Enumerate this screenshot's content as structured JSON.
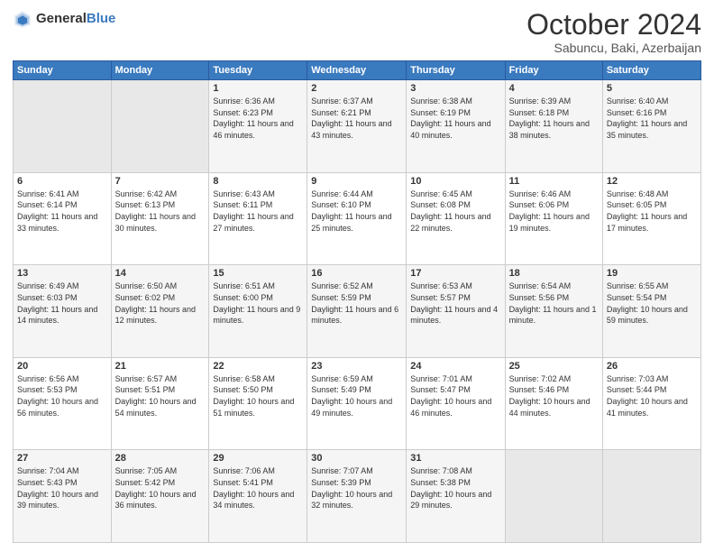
{
  "header": {
    "logo": {
      "general": "General",
      "blue": "Blue"
    },
    "title": "October 2024",
    "location": "Sabuncu, Baki, Azerbaijan"
  },
  "columns": [
    "Sunday",
    "Monday",
    "Tuesday",
    "Wednesday",
    "Thursday",
    "Friday",
    "Saturday"
  ],
  "weeks": [
    [
      {
        "day": "",
        "sunrise": "",
        "sunset": "",
        "daylight": ""
      },
      {
        "day": "",
        "sunrise": "",
        "sunset": "",
        "daylight": ""
      },
      {
        "day": "1",
        "sunrise": "Sunrise: 6:36 AM",
        "sunset": "Sunset: 6:23 PM",
        "daylight": "Daylight: 11 hours and 46 minutes."
      },
      {
        "day": "2",
        "sunrise": "Sunrise: 6:37 AM",
        "sunset": "Sunset: 6:21 PM",
        "daylight": "Daylight: 11 hours and 43 minutes."
      },
      {
        "day": "3",
        "sunrise": "Sunrise: 6:38 AM",
        "sunset": "Sunset: 6:19 PM",
        "daylight": "Daylight: 11 hours and 40 minutes."
      },
      {
        "day": "4",
        "sunrise": "Sunrise: 6:39 AM",
        "sunset": "Sunset: 6:18 PM",
        "daylight": "Daylight: 11 hours and 38 minutes."
      },
      {
        "day": "5",
        "sunrise": "Sunrise: 6:40 AM",
        "sunset": "Sunset: 6:16 PM",
        "daylight": "Daylight: 11 hours and 35 minutes."
      }
    ],
    [
      {
        "day": "6",
        "sunrise": "Sunrise: 6:41 AM",
        "sunset": "Sunset: 6:14 PM",
        "daylight": "Daylight: 11 hours and 33 minutes."
      },
      {
        "day": "7",
        "sunrise": "Sunrise: 6:42 AM",
        "sunset": "Sunset: 6:13 PM",
        "daylight": "Daylight: 11 hours and 30 minutes."
      },
      {
        "day": "8",
        "sunrise": "Sunrise: 6:43 AM",
        "sunset": "Sunset: 6:11 PM",
        "daylight": "Daylight: 11 hours and 27 minutes."
      },
      {
        "day": "9",
        "sunrise": "Sunrise: 6:44 AM",
        "sunset": "Sunset: 6:10 PM",
        "daylight": "Daylight: 11 hours and 25 minutes."
      },
      {
        "day": "10",
        "sunrise": "Sunrise: 6:45 AM",
        "sunset": "Sunset: 6:08 PM",
        "daylight": "Daylight: 11 hours and 22 minutes."
      },
      {
        "day": "11",
        "sunrise": "Sunrise: 6:46 AM",
        "sunset": "Sunset: 6:06 PM",
        "daylight": "Daylight: 11 hours and 19 minutes."
      },
      {
        "day": "12",
        "sunrise": "Sunrise: 6:48 AM",
        "sunset": "Sunset: 6:05 PM",
        "daylight": "Daylight: 11 hours and 17 minutes."
      }
    ],
    [
      {
        "day": "13",
        "sunrise": "Sunrise: 6:49 AM",
        "sunset": "Sunset: 6:03 PM",
        "daylight": "Daylight: 11 hours and 14 minutes."
      },
      {
        "day": "14",
        "sunrise": "Sunrise: 6:50 AM",
        "sunset": "Sunset: 6:02 PM",
        "daylight": "Daylight: 11 hours and 12 minutes."
      },
      {
        "day": "15",
        "sunrise": "Sunrise: 6:51 AM",
        "sunset": "Sunset: 6:00 PM",
        "daylight": "Daylight: 11 hours and 9 minutes."
      },
      {
        "day": "16",
        "sunrise": "Sunrise: 6:52 AM",
        "sunset": "Sunset: 5:59 PM",
        "daylight": "Daylight: 11 hours and 6 minutes."
      },
      {
        "day": "17",
        "sunrise": "Sunrise: 6:53 AM",
        "sunset": "Sunset: 5:57 PM",
        "daylight": "Daylight: 11 hours and 4 minutes."
      },
      {
        "day": "18",
        "sunrise": "Sunrise: 6:54 AM",
        "sunset": "Sunset: 5:56 PM",
        "daylight": "Daylight: 11 hours and 1 minute."
      },
      {
        "day": "19",
        "sunrise": "Sunrise: 6:55 AM",
        "sunset": "Sunset: 5:54 PM",
        "daylight": "Daylight: 10 hours and 59 minutes."
      }
    ],
    [
      {
        "day": "20",
        "sunrise": "Sunrise: 6:56 AM",
        "sunset": "Sunset: 5:53 PM",
        "daylight": "Daylight: 10 hours and 56 minutes."
      },
      {
        "day": "21",
        "sunrise": "Sunrise: 6:57 AM",
        "sunset": "Sunset: 5:51 PM",
        "daylight": "Daylight: 10 hours and 54 minutes."
      },
      {
        "day": "22",
        "sunrise": "Sunrise: 6:58 AM",
        "sunset": "Sunset: 5:50 PM",
        "daylight": "Daylight: 10 hours and 51 minutes."
      },
      {
        "day": "23",
        "sunrise": "Sunrise: 6:59 AM",
        "sunset": "Sunset: 5:49 PM",
        "daylight": "Daylight: 10 hours and 49 minutes."
      },
      {
        "day": "24",
        "sunrise": "Sunrise: 7:01 AM",
        "sunset": "Sunset: 5:47 PM",
        "daylight": "Daylight: 10 hours and 46 minutes."
      },
      {
        "day": "25",
        "sunrise": "Sunrise: 7:02 AM",
        "sunset": "Sunset: 5:46 PM",
        "daylight": "Daylight: 10 hours and 44 minutes."
      },
      {
        "day": "26",
        "sunrise": "Sunrise: 7:03 AM",
        "sunset": "Sunset: 5:44 PM",
        "daylight": "Daylight: 10 hours and 41 minutes."
      }
    ],
    [
      {
        "day": "27",
        "sunrise": "Sunrise: 7:04 AM",
        "sunset": "Sunset: 5:43 PM",
        "daylight": "Daylight: 10 hours and 39 minutes."
      },
      {
        "day": "28",
        "sunrise": "Sunrise: 7:05 AM",
        "sunset": "Sunset: 5:42 PM",
        "daylight": "Daylight: 10 hours and 36 minutes."
      },
      {
        "day": "29",
        "sunrise": "Sunrise: 7:06 AM",
        "sunset": "Sunset: 5:41 PM",
        "daylight": "Daylight: 10 hours and 34 minutes."
      },
      {
        "day": "30",
        "sunrise": "Sunrise: 7:07 AM",
        "sunset": "Sunset: 5:39 PM",
        "daylight": "Daylight: 10 hours and 32 minutes."
      },
      {
        "day": "31",
        "sunrise": "Sunrise: 7:08 AM",
        "sunset": "Sunset: 5:38 PM",
        "daylight": "Daylight: 10 hours and 29 minutes."
      },
      {
        "day": "",
        "sunrise": "",
        "sunset": "",
        "daylight": ""
      },
      {
        "day": "",
        "sunrise": "",
        "sunset": "",
        "daylight": ""
      }
    ]
  ]
}
